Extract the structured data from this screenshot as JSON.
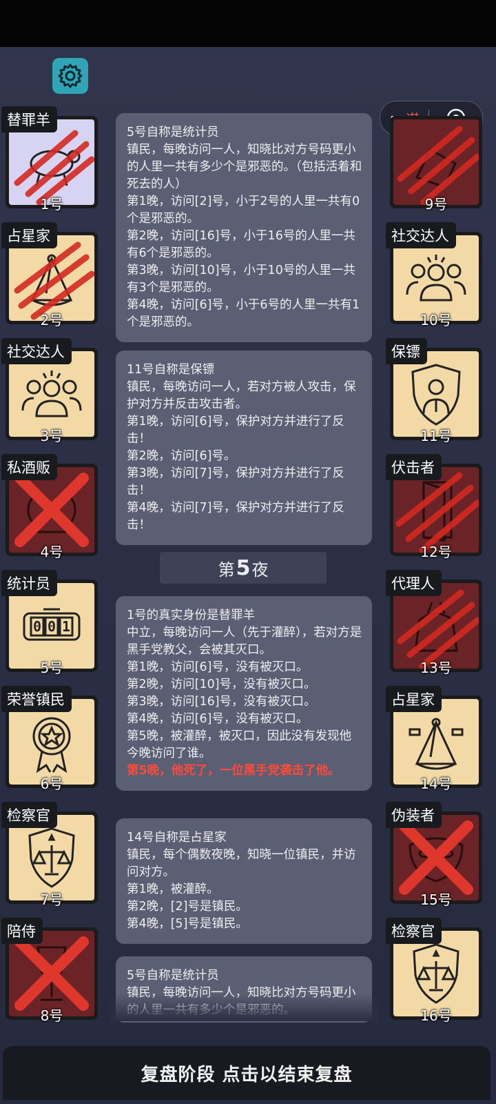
{
  "header": {
    "more_button_text": "谋"
  },
  "colors": {
    "accent": "#2fa5b5",
    "card_tan": "#f2d9a6",
    "card_dead": "#6a2327",
    "alert_red": "#ff4a3a"
  },
  "players_left": [
    {
      "role": "替罪羊",
      "number": "1号",
      "status": "clawed",
      "icon": "lamb-icon"
    },
    {
      "role": "占星家",
      "number": "2号",
      "status": "clawed",
      "icon": "sextant-icon"
    },
    {
      "role": "社交达人",
      "number": "3号",
      "status": "alive",
      "icon": "people-group-icon"
    },
    {
      "role": "私酒贩",
      "number": "4号",
      "status": "crossed",
      "icon": "barrel-icon"
    },
    {
      "role": "统计员",
      "number": "5号",
      "status": "alive",
      "icon": "counter-icon"
    },
    {
      "role": "荣誉镇民",
      "number": "6号",
      "status": "alive",
      "icon": "medal-icon"
    },
    {
      "role": "检察官",
      "number": "7号",
      "status": "alive",
      "icon": "scales-badge-icon"
    },
    {
      "role": "陪侍",
      "number": "8号",
      "status": "crossed",
      "icon": "glass-icon"
    }
  ],
  "players_right": [
    {
      "role": "",
      "number": "9号",
      "status": "clawed",
      "icon": "hand-icon"
    },
    {
      "role": "社交达人",
      "number": "10号",
      "status": "alive",
      "icon": "people-group-icon"
    },
    {
      "role": "保镖",
      "number": "11号",
      "status": "alive",
      "icon": "bodyguard-shield-icon"
    },
    {
      "role": "伏击者",
      "number": "12号",
      "status": "clawed",
      "icon": "door-icon"
    },
    {
      "role": "代理人",
      "number": "13号",
      "status": "clawed",
      "icon": "bag-icon"
    },
    {
      "role": "占星家",
      "number": "14号",
      "status": "alive",
      "icon": "sextant-icon"
    },
    {
      "role": "伪装者",
      "number": "15号",
      "status": "crossed",
      "icon": "mask-icon"
    },
    {
      "role": "检察官",
      "number": "16号",
      "status": "alive",
      "icon": "scales-badge-icon"
    }
  ],
  "log": {
    "msg1": [
      "5号自称是统计员",
      "镇民，每晚访问一人，知晓比对方号码更小的人里一共有多少个是邪恶的。（包括活着和死去的人）",
      "第1晚，访问[2]号，小于2号的人里一共有0个是邪恶的。",
      "第2晚，访问[16]号，小于16号的人里一共有6个是邪恶的。",
      "第3晚，访问[10]号，小于10号的人里一共有3个是邪恶的。",
      "第4晚，访问[6]号，小于6号的人里一共有1个是邪恶的。"
    ],
    "msg2": [
      "11号自称是保镖",
      "镇民，每晚访问一人，若对方被人攻击，保护对方并反击攻击者。",
      "第1晚，访问[6]号，保护对方并进行了反击！",
      "第2晚，访问[6]号。",
      "第3晚，访问[7]号，保护对方并进行了反击！",
      "第4晚，访问[7]号，保护对方并进行了反击！"
    ],
    "night_label_pre": "第",
    "night_number": "5",
    "night_label_post": "夜",
    "msg3": [
      "1号的真实身份是替罪羊",
      "中立，每晚访问一人（先于灌醉），若对方是黑手党教父，会被其灭口。",
      "第1晚，访问[6]号，没有被灭口。",
      "第2晚，访问[10]号，没有被灭口。",
      "第3晚，访问[16]号，没有被灭口。",
      "第4晚，访问[6]号，没有被灭口。",
      "第5晚，被灌醉，被灭口，因此没有发现他今晚访问了谁。"
    ],
    "msg3_alert": "第5晚，他死了，一位黑手党袭击了他。",
    "msg4": [
      "14号自称是占星家",
      "镇民，每个偶数夜晚，知晓一位镇民，并访问对方。",
      "第1晚，被灌醉。",
      "第2晚，[2]号是镇民。",
      "第4晚，[5]号是镇民。"
    ],
    "msg5": [
      "5号自称是统计员",
      "镇民，每晚访问一人，知晓比对方号码更小的人里一共有多少个是邪恶的。"
    ]
  },
  "footer": {
    "label": "复盘阶段 点击以结束复盘"
  }
}
